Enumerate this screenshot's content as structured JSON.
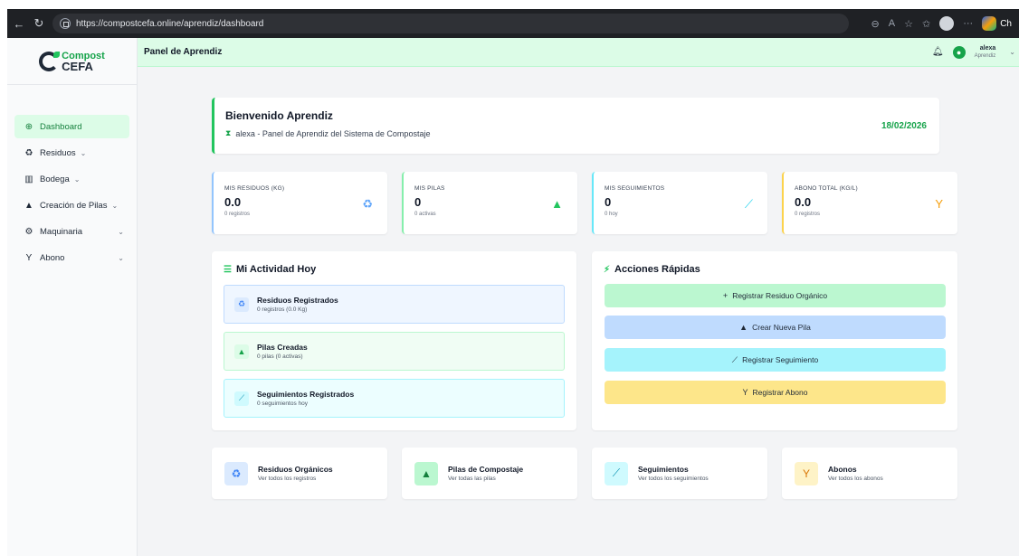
{
  "browser": {
    "url": "https://compostcefa.online/aprendiz/dashboard",
    "copilot_label": "Ch"
  },
  "sidebar": {
    "logo": {
      "top": "Compost",
      "bottom": "CEFA"
    },
    "items": [
      {
        "label": "Dashboard",
        "icon": "palette-icon"
      },
      {
        "label": "Residuos",
        "icon": "recycle-icon"
      },
      {
        "label": "Bodega",
        "icon": "warehouse-icon"
      },
      {
        "label": "Creación de Pilas",
        "icon": "triangle-icon"
      },
      {
        "label": "Maquinaria",
        "icon": "gears-icon"
      },
      {
        "label": "Abono",
        "icon": "seedling-icon"
      }
    ]
  },
  "header": {
    "title": "Panel de Aprendiz",
    "user_name": "alexa",
    "user_role": "Aprendiz"
  },
  "welcome": {
    "title": "Bienvenido Aprendiz",
    "subtitle": "alexa - Panel de Aprendiz del Sistema de Compostaje",
    "date": "18/02/2026"
  },
  "stats": [
    {
      "label": "MIS RESIDUOS (KG)",
      "value": "0.0",
      "sub": "0 registros",
      "color": "#93c5fd"
    },
    {
      "label": "MIS PILAS",
      "value": "0",
      "sub": "0 activas",
      "color": "#86efac"
    },
    {
      "label": "MIS SEGUIMIENTOS",
      "value": "0",
      "sub": "0 hoy",
      "color": "#67e8f9"
    },
    {
      "label": "ABONO TOTAL (KG/L)",
      "value": "0.0",
      "sub": "0 registros",
      "color": "#fcd34d"
    }
  ],
  "activity": {
    "title": "Mi Actividad Hoy",
    "items": [
      {
        "title": "Residuos Registrados",
        "sub": "0 registros (0.0 Kg)"
      },
      {
        "title": "Pilas Creadas",
        "sub": "0 pilas (0 activas)"
      },
      {
        "title": "Seguimientos Registrados",
        "sub": "0 seguimientos hoy"
      }
    ]
  },
  "quick_actions": {
    "title": "Acciones Rápidas",
    "buttons": [
      {
        "label": "Registrar Residuo Orgánico",
        "color": "#bbf7d0"
      },
      {
        "label": "Crear Nueva Pila",
        "color": "#bfdbfe"
      },
      {
        "label": "Registrar Seguimiento",
        "color": "#a5f3fc"
      },
      {
        "label": "Registrar Abono",
        "color": "#fde68a"
      }
    ]
  },
  "bottom_cards": [
    {
      "title": "Residuos Orgánicos",
      "sub": "Ver todos los registros"
    },
    {
      "title": "Pilas de Compostaje",
      "sub": "Ver todas las pilas"
    },
    {
      "title": "Seguimientos",
      "sub": "Ver todos los seguimientos"
    },
    {
      "title": "Abonos",
      "sub": "Ver todos los abonos"
    }
  ]
}
